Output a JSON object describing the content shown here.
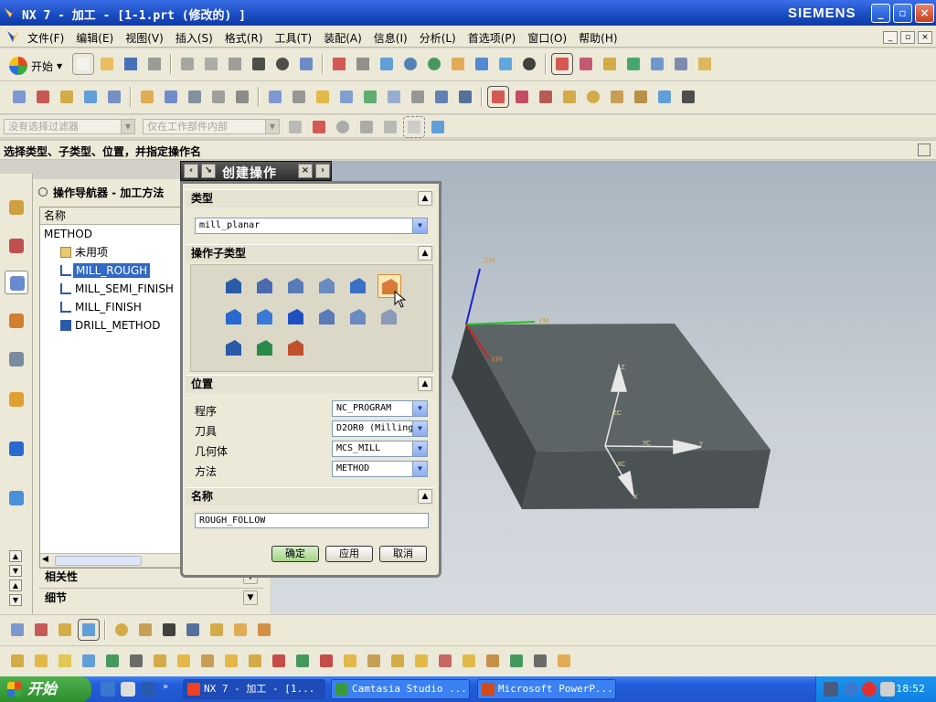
{
  "window": {
    "title": "NX 7 - 加工 - [1-1.prt (修改的) ]",
    "brand": "SIEMENS",
    "buttons": [
      "_",
      "▫",
      "×"
    ]
  },
  "menubar": {
    "items": [
      "文件(F)",
      "编辑(E)",
      "视图(V)",
      "插入(S)",
      "格式(R)",
      "工具(T)",
      "装配(A)",
      "信息(I)",
      "分析(L)",
      "首选项(P)",
      "窗口(O)",
      "帮助(H)"
    ]
  },
  "toolbar": {
    "start_label": "开始"
  },
  "filterbar": {
    "filter_placeholder": "没有选择过滤器",
    "scope_placeholder": "仅在工作部件内部"
  },
  "cue": {
    "text": "选择类型、子类型、位置，并指定操作名"
  },
  "navigator": {
    "title": "操作导航器 - 加工方法",
    "column_header": "名称",
    "rows": [
      {
        "label": "METHOD",
        "selected": false
      },
      {
        "label": "未用项",
        "selected": false
      },
      {
        "label": "MILL_ROUGH",
        "selected": true
      },
      {
        "label": "MILL_SEMI_FINISH",
        "selected": false
      },
      {
        "label": "MILL_FINISH",
        "selected": false
      },
      {
        "label": "DRILL_METHOD",
        "selected": false
      }
    ],
    "sections": [
      "相关性",
      "细节"
    ]
  },
  "dialog": {
    "title": "创建操作",
    "groups": {
      "type": "类型",
      "subtype": "操作子类型",
      "location": "位置",
      "name": "名称"
    },
    "type_value": "mill_planar",
    "location_fields": [
      {
        "label": "程序",
        "value": "NC_PROGRAM"
      },
      {
        "label": "刀具",
        "value": "D2OR0 (Milling"
      },
      {
        "label": "几何体",
        "value": "MCS_MILL"
      },
      {
        "label": "方法",
        "value": "METHOD"
      }
    ],
    "name_value": "ROUGH_FOLLOW",
    "buttons": {
      "ok": "确定",
      "apply": "应用",
      "cancel": "取消"
    }
  },
  "graphics": {
    "axis_labels": {
      "zm": "ZM",
      "ym": "YM",
      "xm": "XM",
      "zc": "ZC",
      "yc": "YC",
      "xc": "XC",
      "z": "Z",
      "y": "Y",
      "x": "X"
    }
  },
  "taskbar": {
    "start_label": "开始",
    "tasks": [
      "NX 7 - 加工 - [1...",
      "Camtasia Studio ...",
      "Microsoft PowerP..."
    ],
    "clock": "18:52"
  },
  "colors": {
    "accent": "#316ac5",
    "model_face_top": "#5d6466",
    "model_face_front": "#474d4f",
    "model_face_side": "#3d4244"
  }
}
